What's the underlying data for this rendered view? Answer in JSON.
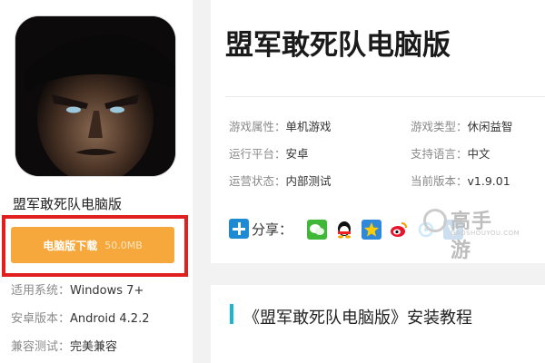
{
  "left": {
    "app_name": "盟军敢死队电脑版",
    "download": {
      "label": "电脑版下载",
      "size": "50.0MB"
    },
    "info": [
      {
        "key": "适用系统：",
        "value": "Windows 7+"
      },
      {
        "key": "安卓版本：",
        "value": "Android 4.2.2"
      },
      {
        "key": "兼容测试：",
        "value": "完美兼容"
      }
    ]
  },
  "main": {
    "title": "盟军敢死队电脑版",
    "meta": [
      {
        "key": "游戏属性：",
        "value": "单机游戏"
      },
      {
        "key": "游戏类型：",
        "value": "休闲益智"
      },
      {
        "key": "运行平台：",
        "value": "安卓"
      },
      {
        "key": "支持语言：",
        "value": "中文"
      },
      {
        "key": "运营状态：",
        "value": "内部测试"
      },
      {
        "key": "当前版本：",
        "value": "v1.9.01"
      }
    ],
    "share_label": "分享：",
    "share_icons": [
      "wechat-icon",
      "qq-icon",
      "qzone-icon",
      "weibo-icon",
      "tencent-weibo-icon",
      "renren-icon"
    ],
    "tutorial_title": "《盟军敢死队电脑版》安装教程"
  },
  "watermark": {
    "text": "高手游",
    "sub": "GAOSHOUYOU.COM"
  },
  "colors": {
    "download": "#f7a83c",
    "highlight": "#e21f1f",
    "accent": "#1bb7cf"
  }
}
